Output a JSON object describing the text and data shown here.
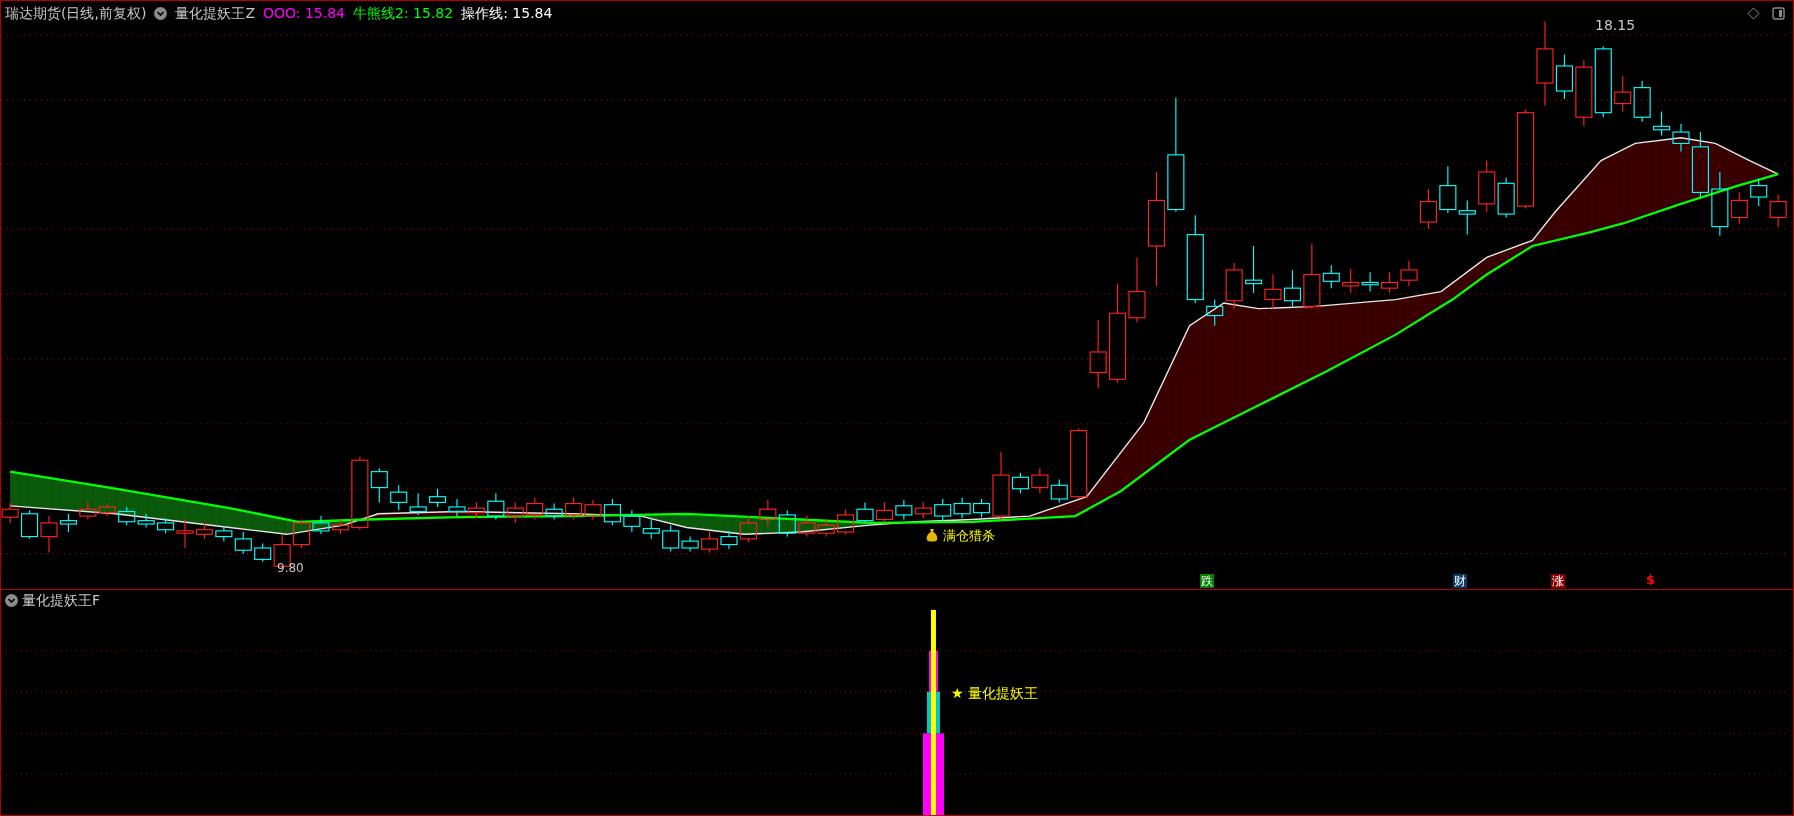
{
  "header": {
    "title": "瑞达期货(日线,前复权)",
    "indicator": "量化提妖王Z",
    "readings": [
      {
        "text": "OOO: 15.84",
        "color": "#ff00ff"
      },
      {
        "text": "牛熊线2: 15.82",
        "color": "#00ff00"
      },
      {
        "text": "操作线: 15.84",
        "color": "#ffffff"
      }
    ]
  },
  "main_chart": {
    "high_label": "18.15",
    "low_label": "9.80",
    "signal": "满仓猎杀",
    "markers": [
      {
        "kind": "badge",
        "text": "跌",
        "color": "#008000"
      },
      {
        "kind": "badge",
        "text": "财",
        "color": "#0b3b6b"
      },
      {
        "kind": "badge",
        "text": "涨",
        "color": "#8b0000"
      },
      {
        "kind": "glyph",
        "text": "$",
        "color": "#ff0000"
      }
    ]
  },
  "sub_chart": {
    "title": "量化提妖王F",
    "label": "★ 量化提妖王"
  }
}
